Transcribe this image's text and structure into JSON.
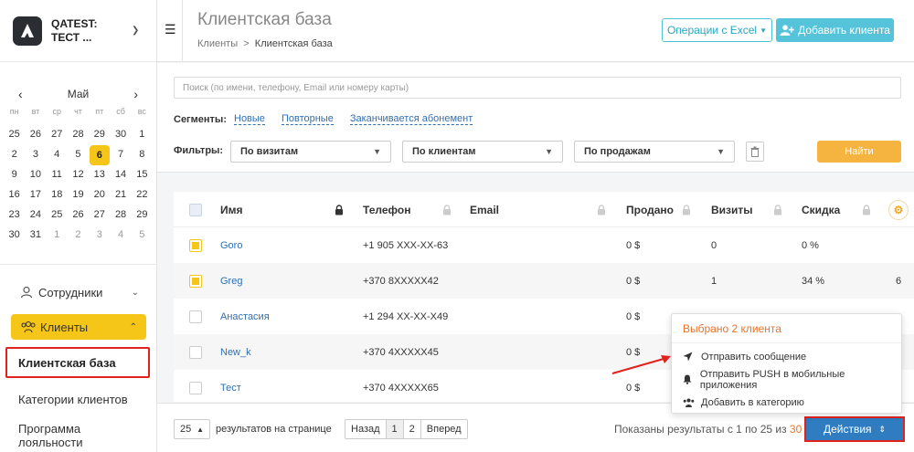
{
  "org": {
    "name": "QATEST: ТЕСТ ..."
  },
  "calendar": {
    "month": "Май",
    "prev": "‹",
    "next": "›",
    "dow": [
      "пн",
      "вт",
      "ср",
      "чт",
      "пт",
      "сб",
      "вс"
    ],
    "weeks": [
      [
        {
          "d": "25",
          "m": false
        },
        {
          "d": "26",
          "m": false
        },
        {
          "d": "27",
          "m": false
        },
        {
          "d": "28",
          "m": false
        },
        {
          "d": "29",
          "m": false
        },
        {
          "d": "30",
          "m": false
        },
        {
          "d": "1",
          "m": false
        }
      ],
      [
        {
          "d": "2",
          "m": false
        },
        {
          "d": "3",
          "m": false
        },
        {
          "d": "4",
          "m": false
        },
        {
          "d": "5",
          "m": false
        },
        {
          "d": "6",
          "m": false,
          "today": true
        },
        {
          "d": "7",
          "m": false
        },
        {
          "d": "8",
          "m": false
        }
      ],
      [
        {
          "d": "9",
          "m": false
        },
        {
          "d": "10",
          "m": false
        },
        {
          "d": "11",
          "m": false
        },
        {
          "d": "12",
          "m": false
        },
        {
          "d": "13",
          "m": false
        },
        {
          "d": "14",
          "m": false
        },
        {
          "d": "15",
          "m": false
        }
      ],
      [
        {
          "d": "16",
          "m": false
        },
        {
          "d": "17",
          "m": false
        },
        {
          "d": "18",
          "m": false
        },
        {
          "d": "19",
          "m": false
        },
        {
          "d": "20",
          "m": false
        },
        {
          "d": "21",
          "m": false
        },
        {
          "d": "22",
          "m": false
        }
      ],
      [
        {
          "d": "23",
          "m": false
        },
        {
          "d": "24",
          "m": false
        },
        {
          "d": "25",
          "m": false
        },
        {
          "d": "26",
          "m": false
        },
        {
          "d": "27",
          "m": false
        },
        {
          "d": "28",
          "m": false
        },
        {
          "d": "29",
          "m": false
        }
      ],
      [
        {
          "d": "30",
          "m": false
        },
        {
          "d": "31",
          "m": false
        },
        {
          "d": "1",
          "m": true
        },
        {
          "d": "2",
          "m": true
        },
        {
          "d": "3",
          "m": true
        },
        {
          "d": "4",
          "m": true
        },
        {
          "d": "5",
          "m": true
        }
      ]
    ]
  },
  "nav": {
    "staff": "Сотрудники",
    "clients": "Клиенты",
    "client_base": "Клиентская база",
    "client_categories": "Категории клиентов",
    "loyalty": "Программа лояльности"
  },
  "header": {
    "title": "Клиентская база",
    "crumb_root": "Клиенты",
    "crumb_sep": ">",
    "crumb_current": "Клиентская база",
    "excel_label": "Операции с Excel",
    "add_label": "Добавить клиента"
  },
  "search": {
    "placeholder": "Поиск (по имени, телефону, Email или номеру карты)"
  },
  "segments": {
    "label": "Сегменты:",
    "items": [
      "Новые",
      "Повторные",
      "Заканчивается абонемент"
    ]
  },
  "filters": {
    "label": "Фильтры:",
    "by_visits": "По визитам",
    "by_clients": "По клиентам",
    "by_sales": "По продажам",
    "find_label": "Найти"
  },
  "table": {
    "columns": {
      "name": "Имя",
      "phone": "Телефон",
      "email": "Email",
      "sold": "Продано",
      "visits": "Визиты",
      "discount": "Скидка"
    },
    "rows": [
      {
        "name": "Goro",
        "phone": "+1 905 XXX-XX-63",
        "email": "",
        "sold": "0 $",
        "visits": "0",
        "discount": "0 %",
        "extra": "",
        "checked": true
      },
      {
        "name": "Greg",
        "phone": "+370 8XXXXX42",
        "email": "",
        "sold": "0 $",
        "visits": "1",
        "discount": "34 %",
        "extra": "6",
        "checked": true
      },
      {
        "name": "Анастасия",
        "phone": "+1 294 XX-XX-X49",
        "email": "",
        "sold": "0 $",
        "visits": "",
        "discount": "",
        "extra": "",
        "checked": false
      },
      {
        "name": "New_k",
        "phone": "+370 4XXXXX45",
        "email": "",
        "sold": "0 $",
        "visits": "",
        "discount": "",
        "extra": "",
        "checked": false
      },
      {
        "name": "Тест",
        "phone": "+370 4XXXXX65",
        "email": "",
        "sold": "0 $",
        "visits": "",
        "discount": "",
        "extra": "",
        "checked": false
      }
    ]
  },
  "footer": {
    "per_page": "25",
    "per_page_label": "результатов на странице",
    "prev": "Назад",
    "pages": [
      "1",
      "2"
    ],
    "next": "Вперед",
    "shown_prefix": "Показаны результаты с 1 по 25 из",
    "shown_total": "30",
    "actions_label": "Действия"
  },
  "popover": {
    "title": "Выбрано 2 клиента",
    "send_message": "Отправить сообщение",
    "send_push": "Отправить PUSH в мобильные приложения",
    "add_category": "Добавить в категорию"
  },
  "colors": {
    "accent_yellow": "#f5c518",
    "primary_blue": "#2f7cc1",
    "teal": "#55c3d9",
    "orange": "#f5b340",
    "highlight_red": "#e0231c"
  }
}
